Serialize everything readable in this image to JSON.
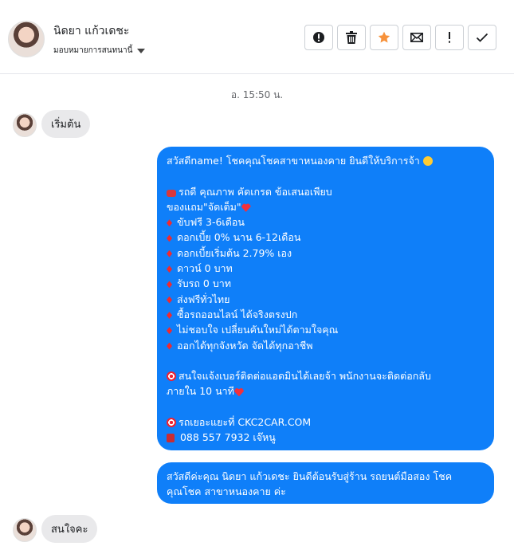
{
  "header": {
    "contact_name": "นิดยา แก้วเดชะ",
    "assign_label": "มอบหมายการสนทนานี้"
  },
  "actions": [
    {
      "name": "spam-alert",
      "icon": "alert-octagon-icon"
    },
    {
      "name": "delete",
      "icon": "trash-icon"
    },
    {
      "name": "star",
      "icon": "star-icon"
    },
    {
      "name": "mark-unread",
      "icon": "envelope-icon"
    },
    {
      "name": "follow-up",
      "icon": "exclamation-icon"
    },
    {
      "name": "done",
      "icon": "check-icon"
    }
  ],
  "colors": {
    "star": "#f7923b",
    "outgoing": "#0f7ff9",
    "incoming": "#e9e9eb",
    "diamond": "#f0292f"
  },
  "conversation": {
    "timestamp": "อ. 15:50 น.",
    "msg1": "เริ่มต้น",
    "out1": {
      "greeting": "สวัสดีname! โชคคุณโชคสาขาหนองคาย ยินดีให้บริการจ้า",
      "l2": "รถดี คุณภาพ คัดเกรด ข้อเสนอเพียบ",
      "l3": "ของแถม\"จัดเต็ม\"",
      "bullets": [
        "ขับฟรี 3-6เดือน",
        "ดอกเบี้ย 0% นาน 6-12เดือน",
        "ดอกเบี้ยเริ่มต้น 2.79% เอง",
        "ดาวน์ 0 บาท",
        "รับรถ 0 บาท",
        "ส่งฟรีทั่วไทย",
        "ซื้อรถออนไลน์ ได้จริงตรงปก",
        "ไม่ชอบใจ เปลี่ยนคันใหม่ได้ตามใจคุณ",
        "ออกได้ทุกจังหวัด จัดได้ทุกอาชีพ"
      ],
      "contact1": "สนใจแจ้งเบอร์ติดต่อแอดมินได้เลยจ้า พนักงานจะติดต่อกลับ",
      "contact2": "ภายใน 10 นาที",
      "site": "รถเยอะแยะที่ CKC2CAR.COM",
      "phone": "088 557 7932 เจ๊หนู"
    },
    "out2_line1": "สวัสดีค่ะคุณ นิดยา แก้วเดชะ ยินดีต้อนรับสู่ร้าน รถยนต์มือสอง โชค",
    "out2_line2": "คุณโชค สาขาหนองคาย ค่ะ",
    "msg2": "สนใจคะ"
  }
}
